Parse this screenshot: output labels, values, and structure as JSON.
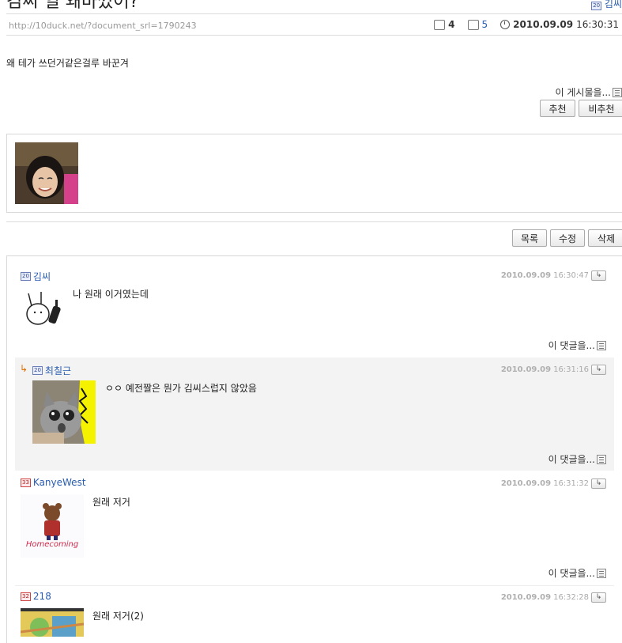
{
  "post": {
    "title": "김씨 얼 왜바꼈어?",
    "author": "김씨",
    "url": "http://10duck.net/?document_srl=1790243",
    "comment_count": "4",
    "read_count": "5",
    "date": "2010.09.09",
    "time": "16:30:31",
    "body": "왜 테가 쓰던거같은걸루 바꾼겨",
    "more_label": "이 게시물을...",
    "recommend_label": "추천",
    "unrecommend_label": "비추천"
  },
  "actions": {
    "list": "목록",
    "edit": "수정",
    "delete": "삭제"
  },
  "comments": [
    {
      "name": "김씨",
      "level": "20",
      "date": "2010.09.09",
      "time": "16:30:47",
      "text": "나 원래 이거였는데",
      "more": "이 댓글을..."
    },
    {
      "name": "최칠근",
      "level": "20",
      "date": "2010.09.09",
      "time": "16:31:16",
      "text": "ㅇㅇ 예전짤은 뭔가 김씨스럽지 않았음",
      "more": "이 댓글을..."
    },
    {
      "name": "KanyeWest",
      "level": "33",
      "date": "2010.09.09",
      "time": "16:31:32",
      "text": "원래 저거",
      "more": "이 댓글을...",
      "avatar_text": "Homecoming"
    },
    {
      "name": "218",
      "level": "32",
      "date": "2010.09.09",
      "time": "16:32:28",
      "text": "원래 저거(2)"
    }
  ],
  "colors": {
    "link": "#2a5db0",
    "muted": "#aaaaaa",
    "reply_bg": "#f3f3f3"
  }
}
